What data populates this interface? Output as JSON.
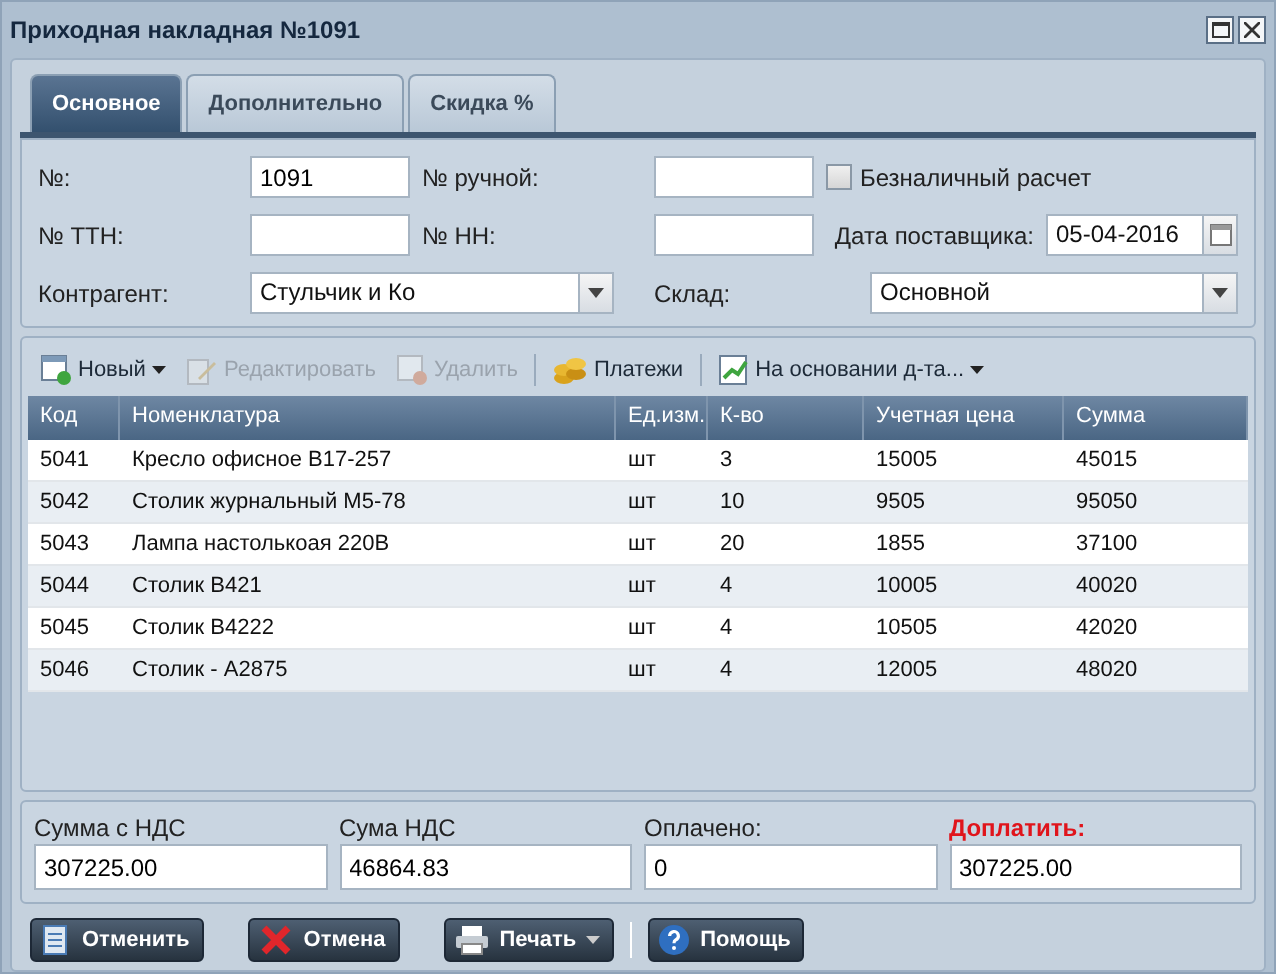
{
  "window": {
    "title": "Приходная накладная №1091"
  },
  "tabs": [
    {
      "label": "Основное",
      "selected": true
    },
    {
      "label": "Дополнительно",
      "selected": false
    },
    {
      "label": "Скидка %",
      "selected": false
    }
  ],
  "form": {
    "number": {
      "label": "№:",
      "value": "1091"
    },
    "manual_number": {
      "label": "№ ручной:"
    },
    "cashless": {
      "label": "Безналичный расчет",
      "checked": false
    },
    "ttn": {
      "label": "№ ТТН:"
    },
    "nn": {
      "label": "№ НН:"
    },
    "supplier_date": {
      "label": "Дата поставщика:",
      "value": "05-04-2016"
    },
    "counterparty": {
      "label": "Контрагент:",
      "value": "Стульчик и Ко"
    },
    "warehouse": {
      "label": "Склад:",
      "value": "Основной"
    }
  },
  "toolbar": {
    "groups": [
      [
        {
          "kind": "new",
          "label": "Новый",
          "disabled": false,
          "dropdown": true
        },
        {
          "kind": "edit",
          "label": "Редактировать",
          "disabled": true,
          "dropdown": false
        },
        {
          "kind": "delete",
          "label": "Удалить",
          "disabled": true,
          "dropdown": false
        }
      ],
      [
        {
          "kind": "payments",
          "label": "Платежи",
          "disabled": false,
          "dropdown": false
        }
      ],
      [
        {
          "kind": "based",
          "label": "На основании д-та...",
          "disabled": false,
          "dropdown": true
        }
      ]
    ]
  },
  "table": {
    "columns": [
      "Код",
      "Номенклатура",
      "Ед.изм.",
      "К-во",
      "Учетная цена",
      "Сумма"
    ],
    "rows": [
      [
        "5041",
        "Кресло офисное B17-257",
        "шт",
        "3",
        "15005",
        "45015"
      ],
      [
        "5042",
        "Столик журнальный M5-78",
        "шт",
        "10",
        "9505",
        "95050"
      ],
      [
        "5043",
        "Лампа настолькоая 220В",
        "шт",
        "20",
        "1855",
        "37100"
      ],
      [
        "5044",
        "Столик B421",
        "шт",
        "4",
        "10005",
        "40020"
      ],
      [
        "5045",
        "Столик B4222",
        "шт",
        "4",
        "10505",
        "42020"
      ],
      [
        "5046",
        "Столик - A2875",
        "шт",
        "4",
        "12005",
        "48020"
      ]
    ]
  },
  "totals": [
    {
      "label": "Сумма с НДС",
      "value": "307225.00",
      "highlight": false
    },
    {
      "label": "Сума НДС",
      "value": "46864.83",
      "highlight": false
    },
    {
      "label": "Оплачено:",
      "value": "0",
      "highlight": false
    },
    {
      "label": "Доплатить:",
      "value": "307225.00",
      "highlight": true
    }
  ],
  "buttons": {
    "groups": [
      [
        {
          "kind": "save",
          "label": "Отменить",
          "dropdown": false
        },
        {
          "kind": "cancel",
          "label": "Отмена",
          "dropdown": false
        },
        {
          "kind": "print",
          "label": "Печать",
          "dropdown": true
        }
      ],
      [
        {
          "kind": "help",
          "label": "Помощь",
          "dropdown": false
        }
      ]
    ]
  }
}
